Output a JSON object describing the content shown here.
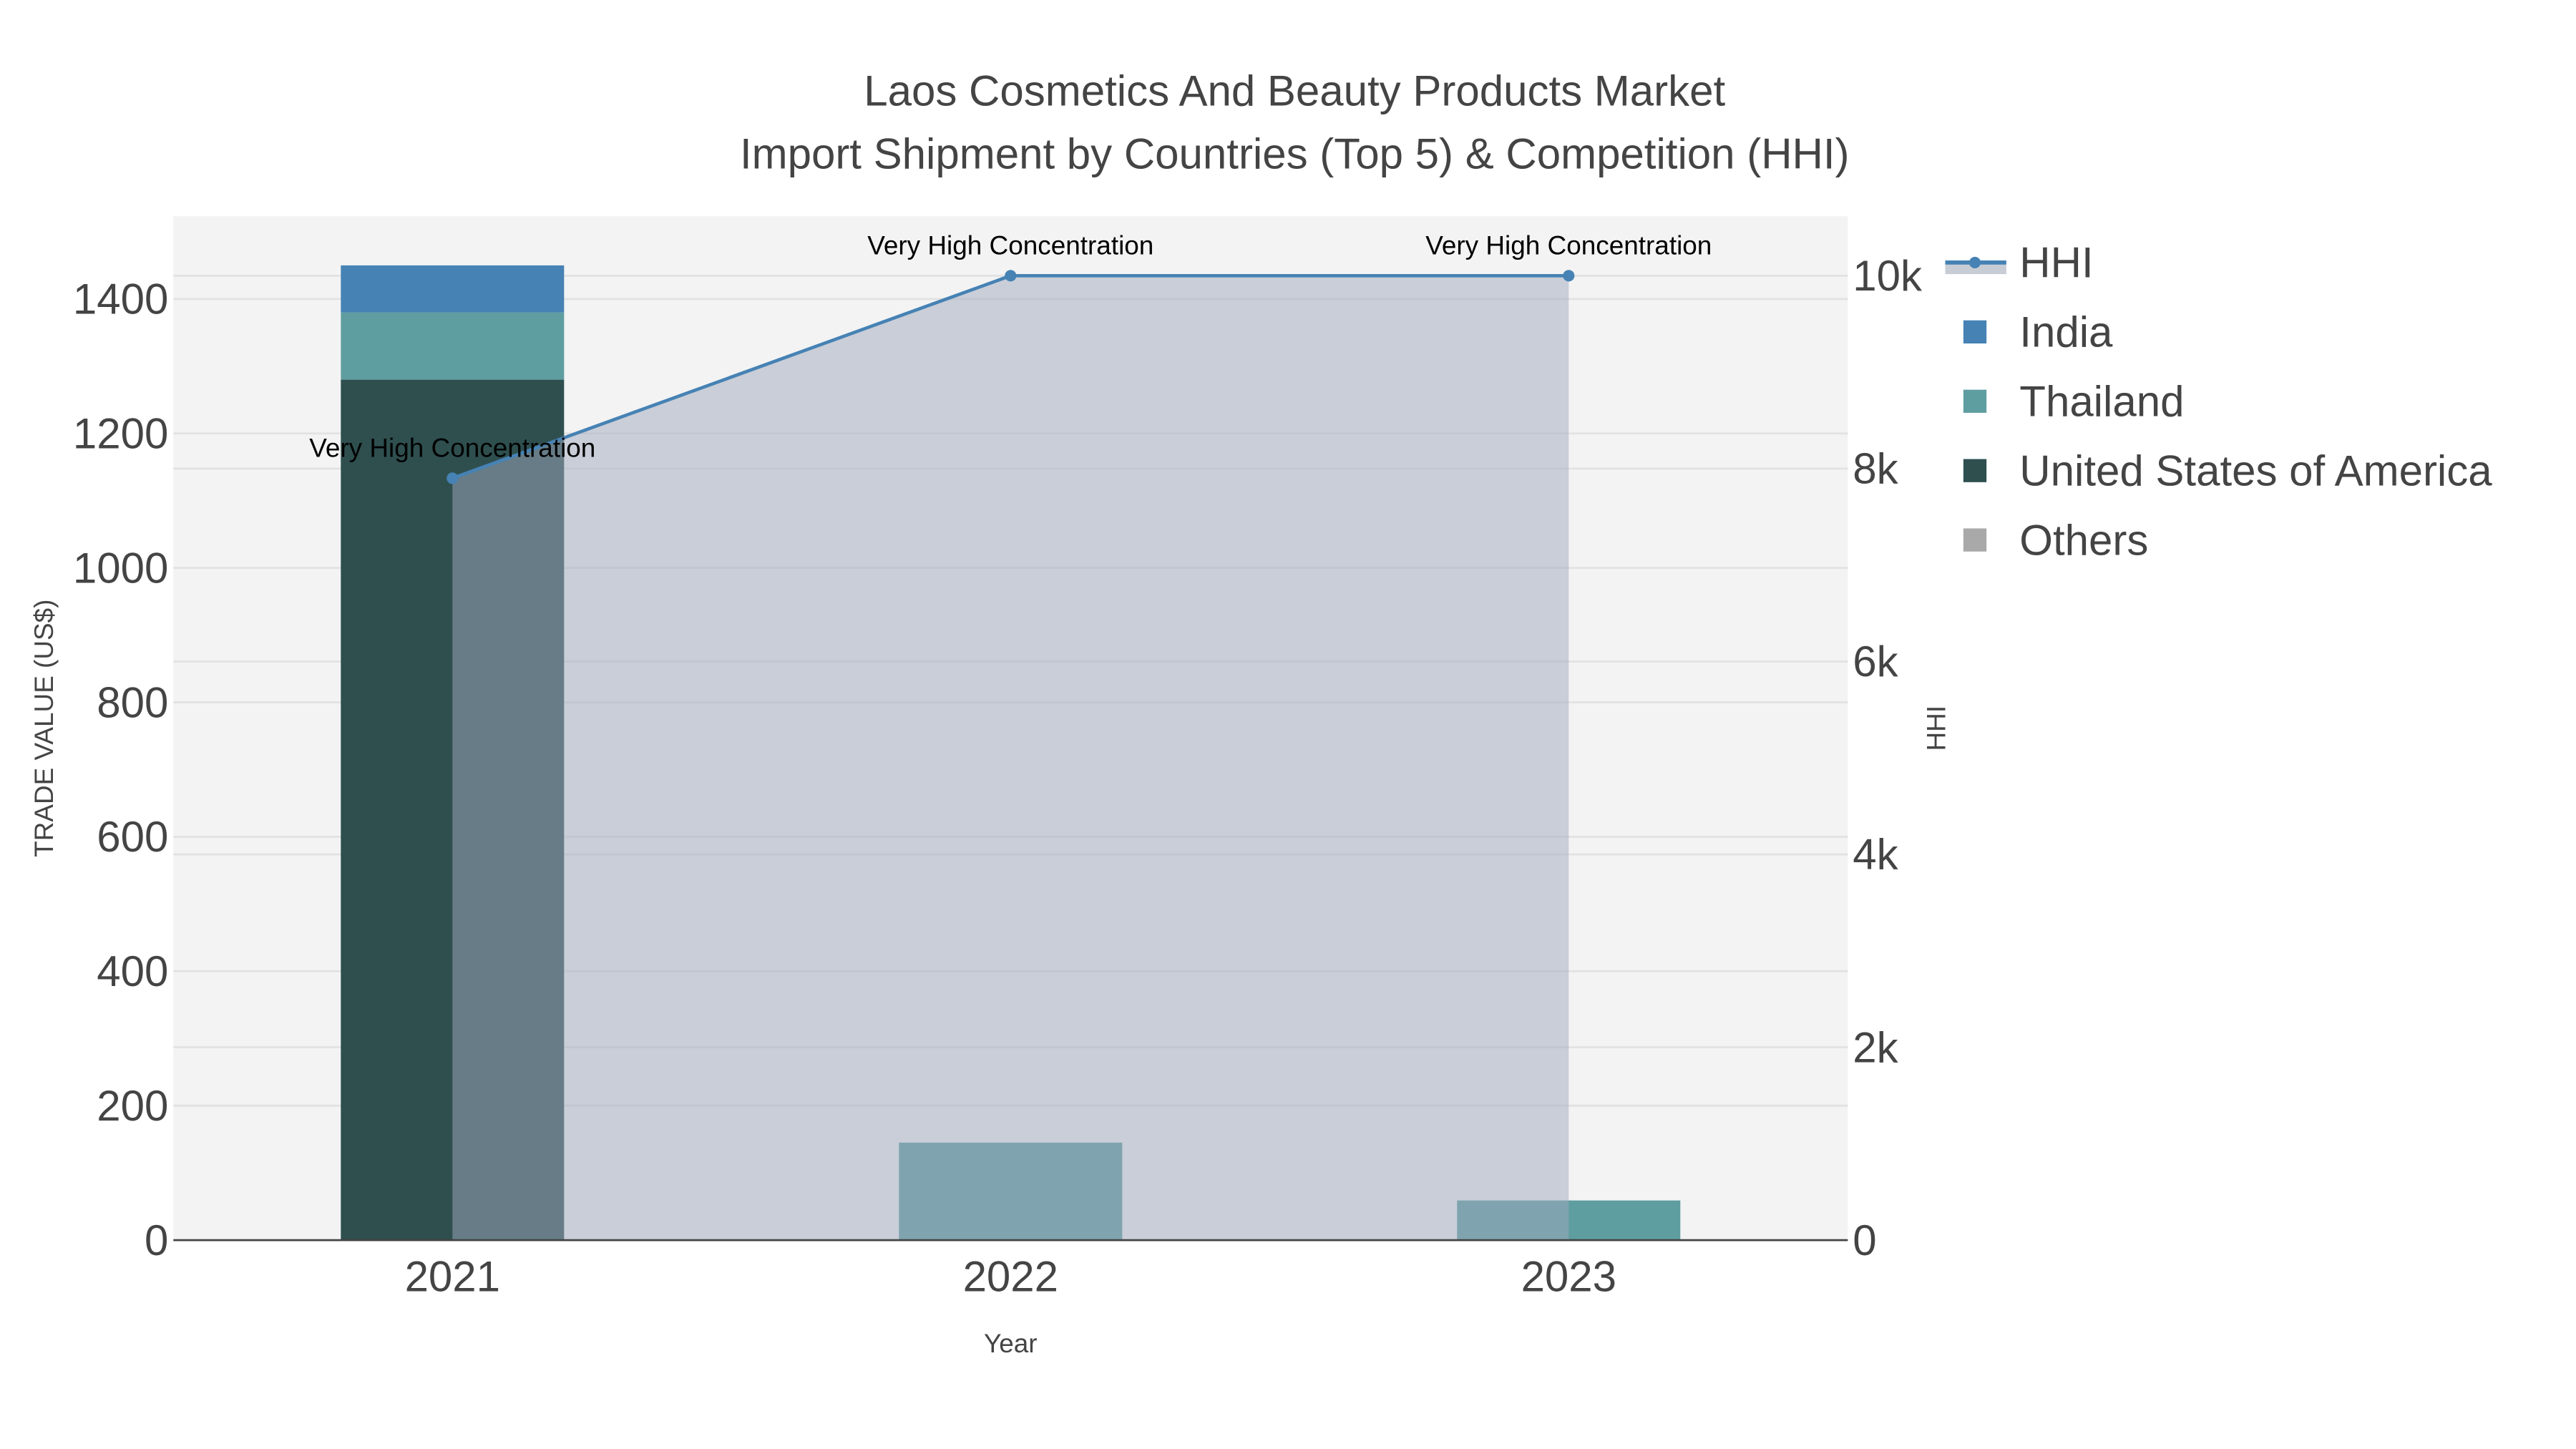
{
  "chart_data": {
    "type": "bar",
    "title_line1": "Laos Cosmetics And Beauty Products Market",
    "title_line2": "Import Shipment by Countries (Top 5) & Competition (HHI)",
    "xlabel": "Year",
    "ylabel": "TRADE VALUE (US$)",
    "y2label": "HHI",
    "categories": [
      "2021",
      "2022",
      "2023"
    ],
    "ylim": [
      0,
      1523
    ],
    "yticks": [
      0,
      200,
      400,
      600,
      800,
      1000,
      1200,
      1400
    ],
    "y2lim": [
      0,
      10616
    ],
    "y2ticks": [
      0,
      2000,
      4000,
      6000,
      8000,
      10000
    ],
    "y2ticklabels": [
      "0",
      "2k",
      "4k",
      "6k",
      "8k",
      "10k"
    ],
    "grid": true,
    "legend_position": "right",
    "barmode": "stack",
    "series": [
      {
        "name": "United States of America",
        "color": "#2f4f4f",
        "values": [
          1280,
          0,
          0
        ]
      },
      {
        "name": "Thailand",
        "color": "#5f9ea0",
        "values": [
          100,
          145,
          59
        ]
      },
      {
        "name": "India",
        "color": "#4682b4",
        "values": [
          70,
          0,
          0
        ]
      },
      {
        "name": "Others",
        "color": "#a9a9a9",
        "values": [
          0,
          0,
          0
        ]
      }
    ],
    "line": {
      "name": "HHI",
      "color": "#4682b4",
      "fill": "rgba(160,170,190,0.5)",
      "values": [
        7900,
        10000,
        10000
      ],
      "annotations": [
        "Very High Concentration",
        "Very High Concentration",
        "Very High Concentration"
      ]
    },
    "legend_order": [
      "HHI",
      "India",
      "Thailand",
      "United States of America",
      "Others"
    ]
  }
}
